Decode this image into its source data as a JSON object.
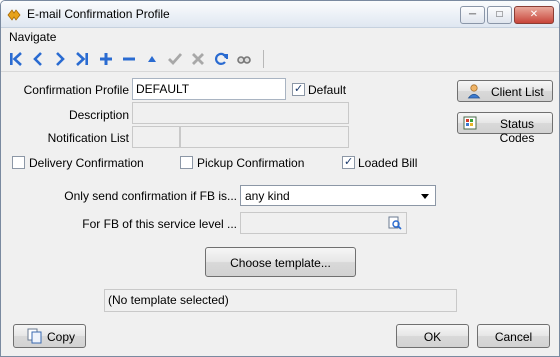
{
  "window": {
    "title": "E-mail Confirmation Profile"
  },
  "menu": {
    "items": [
      {
        "label": "Navigate"
      }
    ]
  },
  "toolbar": {
    "buttons": [
      {
        "name": "first-record",
        "icon": "skip-first-icon"
      },
      {
        "name": "previous-record",
        "icon": "chevron-left-icon"
      },
      {
        "name": "next-record",
        "icon": "chevron-right-icon"
      },
      {
        "name": "last-record",
        "icon": "skip-last-icon"
      },
      {
        "name": "add-record",
        "icon": "plus-icon"
      },
      {
        "name": "delete-record",
        "icon": "minus-icon"
      },
      {
        "name": "edit-record",
        "icon": "triangle-up-icon"
      },
      {
        "name": "save-record",
        "icon": "check-icon"
      },
      {
        "name": "cancel-edit",
        "icon": "x-icon"
      },
      {
        "name": "refresh",
        "icon": "refresh-icon"
      },
      {
        "name": "view",
        "icon": "glasses-icon"
      }
    ]
  },
  "form": {
    "confirmation_profile": {
      "label": "Confirmation Profile",
      "value": "DEFAULT"
    },
    "default": {
      "label": "Default",
      "checked": true
    },
    "description": {
      "label": "Description",
      "value": ""
    },
    "notification_list": {
      "label": "Notification List",
      "value_code": "",
      "value_name": ""
    },
    "delivery_confirmation": {
      "label": "Delivery Confirmation",
      "checked": false
    },
    "pickup_confirmation": {
      "label": "Pickup Confirmation",
      "checked": false
    },
    "loaded_bill": {
      "label": "Loaded Bill",
      "checked": true
    },
    "only_send": {
      "label": "Only send confirmation if FB is...",
      "selected": "any kind"
    },
    "service_level": {
      "label": "For FB of this service level ...",
      "value": ""
    },
    "choose_template": {
      "label": "Choose template..."
    },
    "template_status": "(No template selected)"
  },
  "side_buttons": {
    "client_list": "Client List",
    "status_codes": "Status Codes"
  },
  "footer": {
    "copy": "Copy",
    "ok": "OK",
    "cancel": "Cancel"
  },
  "colors": {
    "toolbar_icon": "#2a6bd1",
    "title_gradient_top": "#fbfcfd",
    "window_bg": "#f0f0f0"
  }
}
